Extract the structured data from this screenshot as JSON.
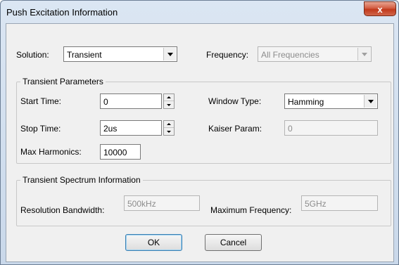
{
  "window": {
    "title": "Push Excitation Information",
    "close_glyph": "x"
  },
  "solution": {
    "label": "Solution:",
    "value": "Transient"
  },
  "frequency": {
    "label": "Frequency:",
    "value": "All Frequencies"
  },
  "transient_parameters": {
    "group_label": "Transient Parameters",
    "start_time": {
      "label": "Start Time:",
      "value": "0"
    },
    "stop_time": {
      "label": "Stop Time:",
      "value": "2us"
    },
    "max_harmonics": {
      "label": "Max Harmonics:",
      "value": "10000"
    },
    "window_type": {
      "label": "Window Type:",
      "value": "Hamming"
    },
    "kaiser_param": {
      "label": "Kaiser Param:",
      "value": "0"
    }
  },
  "spectrum": {
    "group_label": "Transient Spectrum Information",
    "resolution_bandwidth": {
      "label": "Resolution Bandwidth:",
      "value": "500kHz"
    },
    "maximum_frequency": {
      "label": "Maximum Frequency:",
      "value": "5GHz"
    }
  },
  "buttons": {
    "ok": "OK",
    "cancel": "Cancel"
  },
  "colors": {
    "client_background": "#f0f0f0",
    "close_button": "#c1391b"
  }
}
